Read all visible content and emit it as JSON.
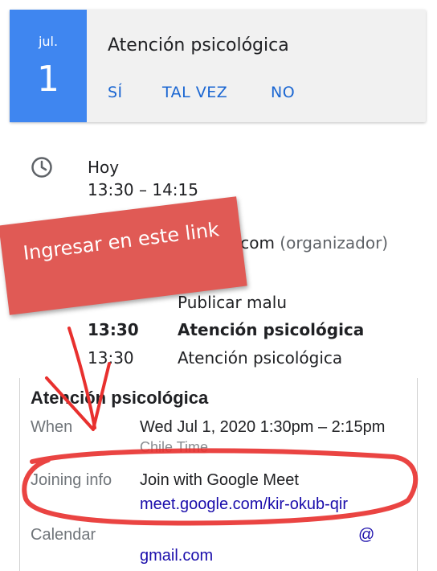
{
  "event": {
    "month": "jul.",
    "day": "1",
    "title": "Atención psicológica",
    "rsvp_yes": "SÍ",
    "rsvp_maybe": "TAL VEZ",
    "rsvp_no": "NO"
  },
  "details": {
    "day_label": "Hoy",
    "time_range": "13:30 – 14:15",
    "organizer_email": "mail.com",
    "organizer_suffix": "(organizador)"
  },
  "agenda": [
    {
      "time": "",
      "title": "Publicar malu"
    },
    {
      "time": "13:30",
      "title": "Atención psicológica"
    },
    {
      "time": "13:30",
      "title": "Atención psicológica"
    }
  ],
  "annotation": {
    "callout_text": "Ingresar en este link",
    "circle_color": "#e8302e"
  },
  "invite": {
    "title": "Atención psicológica",
    "when_label": "When",
    "when_value": "Wed Jul 1, 2020 1:30pm – 2:15pm",
    "timezone": "Chile Time",
    "joining_label": "Joining info",
    "join_text": "Join with Google Meet",
    "meet_link": "meet.google.com/kir-okub-qir",
    "calendar_label": "Calendar",
    "calendar_at": "@",
    "calendar_domain": "gmail.com"
  },
  "colors": {
    "accent": "#3f86f0",
    "link": "#1a66d2",
    "callout": "#e05a55"
  }
}
